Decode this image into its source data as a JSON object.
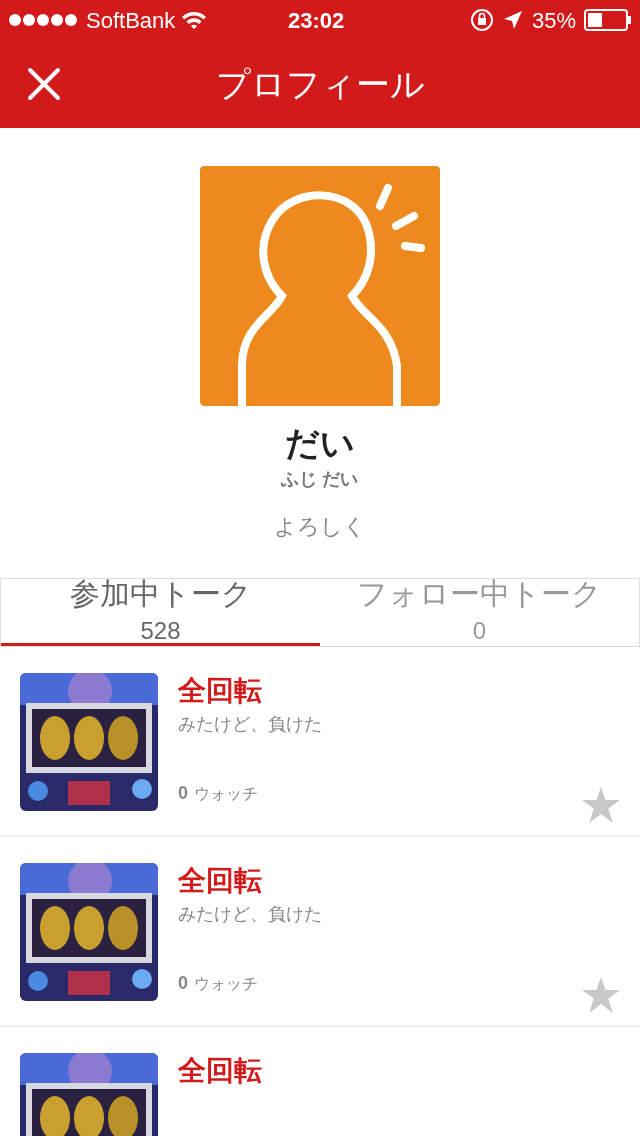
{
  "status_bar": {
    "carrier": "SoftBank",
    "time": "23:02",
    "battery": "35%"
  },
  "nav": {
    "title": "プロフィール"
  },
  "profile": {
    "name": "だい",
    "reading": "ふじ だい",
    "bio": "よろしく"
  },
  "tabs": [
    {
      "label": "参加中トーク",
      "count": "528",
      "selected": true
    },
    {
      "label": "フォロー中トーク",
      "count": "0",
      "selected": false
    }
  ],
  "talks": [
    {
      "title": "全回転",
      "subtitle": "みたけど、負けた",
      "watch_count": "0",
      "watch_label": "ウォッチ",
      "starred": false
    },
    {
      "title": "全回転",
      "subtitle": "みたけど、負けた",
      "watch_count": "0",
      "watch_label": "ウォッチ",
      "starred": false
    },
    {
      "title": "全回転"
    }
  ]
}
